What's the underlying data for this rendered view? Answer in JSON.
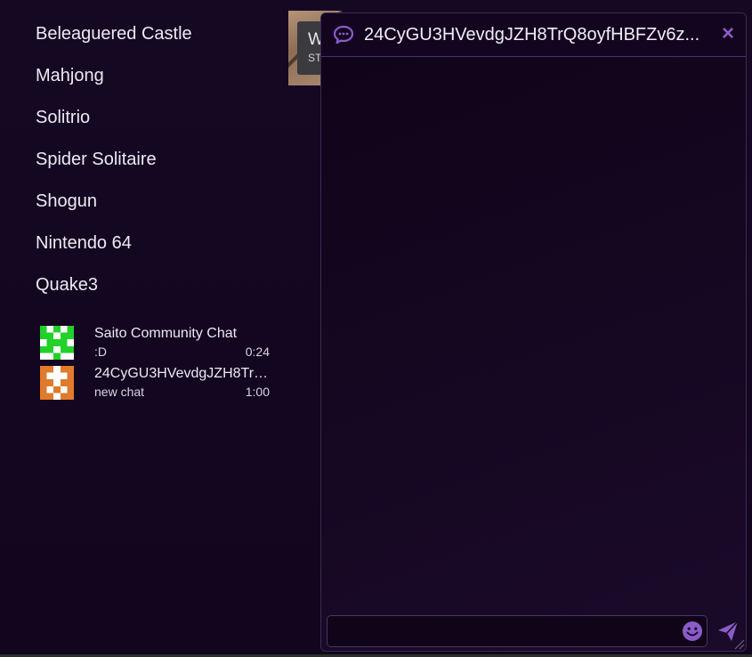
{
  "games": [
    {
      "label": "Beleaguered Castle"
    },
    {
      "label": "Mahjong"
    },
    {
      "label": "Solitrio"
    },
    {
      "label": "Spider Solitaire"
    },
    {
      "label": "Shogun"
    },
    {
      "label": "Nintendo 64"
    },
    {
      "label": "Quake3"
    }
  ],
  "chats": [
    {
      "name": "Saito Community Chat",
      "last_message": ":D",
      "time": "0:24",
      "avatar_color": "#22d12a",
      "avatar_icon": "identicon-green"
    },
    {
      "name": "24CyGU3HVevdgJZH8TrQ8oyfHBFZv6z...",
      "last_message": "new chat",
      "time": "1:00",
      "avatar_color": "#e07a2c",
      "avatar_icon": "identicon-orange"
    }
  ],
  "background_tile": {
    "title": "W",
    "subtitle": "ST"
  },
  "chat_window": {
    "title": "24CyGU3HVevdgJZH8TrQ8oyfHBFZv6z...",
    "header_icon": "chat-bubble-icon",
    "close_label": "×",
    "input_placeholder": "",
    "input_value": "",
    "emoji_icon": "smiley-icon",
    "send_icon": "paper-plane-icon",
    "accent_color": "#8a5cc8"
  }
}
